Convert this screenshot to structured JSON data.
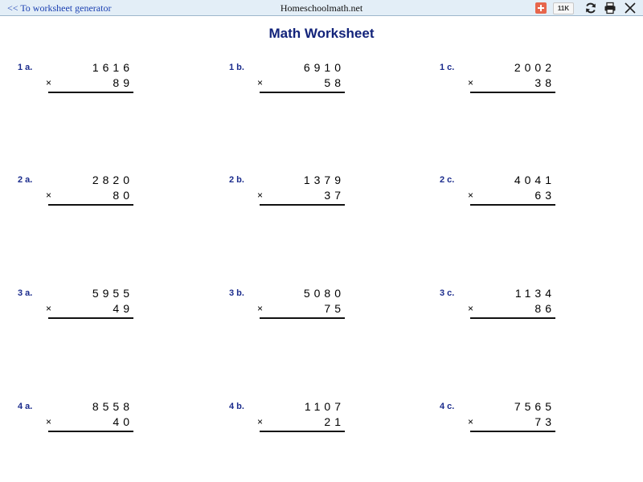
{
  "toolbar": {
    "back_link": "<< To worksheet generator",
    "site_name": "Homeschoolmath.net",
    "share_count": "11K"
  },
  "worksheet": {
    "title": "Math Worksheet",
    "operator": "×",
    "problems": [
      {
        "label": "1 a.",
        "top": "1616",
        "bottom": "89"
      },
      {
        "label": "1 b.",
        "top": "6910",
        "bottom": "58"
      },
      {
        "label": "1 c.",
        "top": "2002",
        "bottom": "38"
      },
      {
        "label": "2 a.",
        "top": "2820",
        "bottom": "80"
      },
      {
        "label": "2 b.",
        "top": "1379",
        "bottom": "37"
      },
      {
        "label": "2 c.",
        "top": "4041",
        "bottom": "63"
      },
      {
        "label": "3 a.",
        "top": "5955",
        "bottom": "49"
      },
      {
        "label": "3 b.",
        "top": "5080",
        "bottom": "75"
      },
      {
        "label": "3 c.",
        "top": "1134",
        "bottom": "86"
      },
      {
        "label": "4 a.",
        "top": "8558",
        "bottom": "40"
      },
      {
        "label": "4 b.",
        "top": "1107",
        "bottom": "21"
      },
      {
        "label": "4 c.",
        "top": "7565",
        "bottom": "73"
      }
    ]
  },
  "colors": {
    "toolbar_bg": "#e3eef7",
    "link": "#1a3fb0",
    "title": "#12237a",
    "label": "#1a2b8c",
    "share_button": "#e7664c"
  },
  "icons": [
    "plus-icon",
    "refresh-icon",
    "print-icon",
    "close-icon"
  ]
}
